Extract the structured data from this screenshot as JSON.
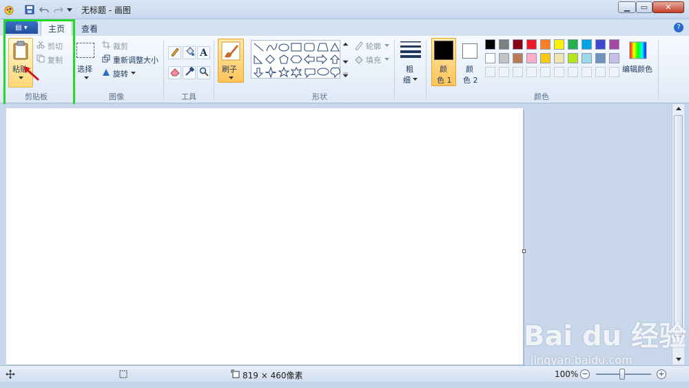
{
  "titlebar": {
    "title": "无标题 - 画图"
  },
  "tabs": {
    "home": "主页",
    "view": "查看"
  },
  "clipboard": {
    "paste": "粘贴",
    "cut": "剪切",
    "copy": "复制",
    "group": "剪贴板"
  },
  "image": {
    "select": "选择",
    "crop": "裁剪",
    "resize": "重新调整大小",
    "rotate": "旋转",
    "group": "图像"
  },
  "tools": {
    "group": "工具",
    "text_glyph": "A"
  },
  "brushes": {
    "label": "刷子"
  },
  "shapes": {
    "outline": "轮廓",
    "fill": "填充",
    "group": "形状"
  },
  "size": {
    "label_line1": "粗",
    "label_line2": "细"
  },
  "colors": {
    "color1_line1": "颜",
    "color1_line2": "色 1",
    "color2_line1": "颜",
    "color2_line2": "色 2",
    "edit": "编辑颜色",
    "group": "颜色",
    "palette_row1": [
      "#000000",
      "#7f7f7f",
      "#880015",
      "#ed1c24",
      "#ff7f27",
      "#fff200",
      "#22b14c",
      "#00a2e8",
      "#3f48cc",
      "#a349a4"
    ],
    "palette_row2": [
      "#ffffff",
      "#c3c3c3",
      "#b97a57",
      "#ffaec9",
      "#ffc90e",
      "#efe4b0",
      "#b5e61d",
      "#99d9ea",
      "#7092be",
      "#c8bfe7"
    ]
  },
  "status": {
    "dimensions": "819 × 460像素",
    "zoom": "100%"
  },
  "watermark": {
    "brand": "Bai du 经验",
    "url": "jingyan.baidu.com"
  }
}
